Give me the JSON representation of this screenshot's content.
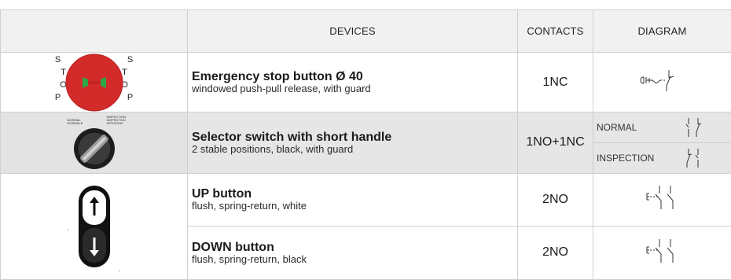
{
  "header": {
    "devices": "DEVICES",
    "contacts": "CONTACTS",
    "diagram": "DIAGRAM"
  },
  "rows": [
    {
      "title": "Emergency stop button Ø 40",
      "subtitle": "windowed push-pull release, with guard",
      "contacts": "1NC",
      "image": "emergency-stop-icon",
      "stop_letters": [
        "S",
        "T",
        "O",
        "P"
      ]
    },
    {
      "title": "Selector switch with short handle",
      "subtitle": "2 stable positions, black, with guard",
      "contacts": "1NO+1NC",
      "image": "selector-switch-icon",
      "positions": [
        {
          "label": "NORMAL"
        },
        {
          "label": "INSPECTION"
        }
      ],
      "switch_left_text": [
        "NORMAL",
        "NORMALE"
      ],
      "switch_right_text": [
        "INSPECTION",
        "INSPEKTION",
        "ISPEZIONE"
      ]
    },
    {
      "title": "UP button",
      "subtitle": "flush, spring-return, white",
      "contacts": "2NO",
      "image": "up-down-button-icon"
    },
    {
      "title": "DOWN button",
      "subtitle": "flush, spring-return, black",
      "contacts": "2NO"
    }
  ],
  "colors": {
    "header_bg": "#f1f1f1",
    "shaded_row_bg": "#e6e6e6",
    "stop_red": "#d32a2a",
    "indicator_green": "#2ba84a",
    "border": "#cfcfcf"
  }
}
